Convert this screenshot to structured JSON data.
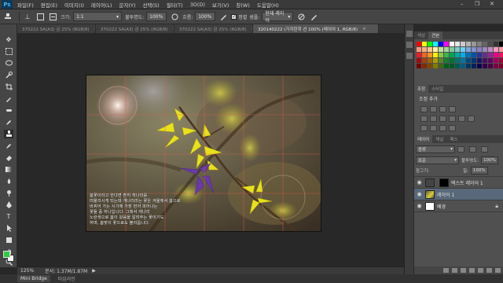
{
  "app": {
    "logo": "Ps"
  },
  "menu": [
    "파일(F)",
    "편집(E)",
    "이미지(I)",
    "레이어(L)",
    "문자(Y)",
    "선택(S)",
    "필터(T)",
    "3D(D)",
    "보기(V)",
    "창(W)",
    "도움말(H)"
  ],
  "window_controls": {
    "minimize": "–",
    "restore": "❐",
    "close": "✕"
  },
  "options": {
    "tool_preset": "⊥",
    "label_size": "크기:",
    "size_value": "1:1",
    "mode_label": "불투명도:",
    "mode_value": "100%",
    "opacity_label": "흐름:",
    "opacity_value": "100%",
    "align_label": "정렬",
    "sample_label": "샘플:",
    "sample_value": "현재 레이어",
    "align_checked": "✓"
  },
  "tabs": [
    {
      "label": "370222 SA(A3) 금 25% (RGB/8)",
      "active": false
    },
    {
      "label": "370222 SA(A3) 금 25% (RGB/8)",
      "active": false
    },
    {
      "label": "370222 SA(A3) 금 25% (RGB/8)",
      "active": false
    },
    {
      "label": "320140222 (가지런히 선 100% (레이어 1, RGB/8)",
      "active": true
    }
  ],
  "tab_close": "×",
  "caption": {
    "lines": [
      "봄꽃이라고 한다면 흔히 개나리를",
      "떠올리시게 되는데 개나리라는 꽃은 겨울에서 봄으로",
      "바뀌어 가는 시기에 가장 먼저 피어나는",
      "꽃들 중 하나입니다. 그래서 개나리",
      "노란색으로 봄이 왔음을 알려주는 꽃이기도",
      "하며, 봄맞이 꽃으로도 불리웁니다."
    ]
  },
  "status": {
    "zoom": "125%",
    "doc": "문서: 1.37M/1.87M",
    "arrow": "▶"
  },
  "bottom_tabs": [
    "Mini Bridge",
    "타임라인"
  ],
  "panels": {
    "swatches_tabs": [
      "색상",
      "견본"
    ],
    "adjust_tabs": [
      "조정",
      "스타일"
    ],
    "adjust_title": "조정 추가",
    "layers_tabs": [
      "레이어",
      "채널",
      "패스"
    ],
    "kind_label": "종류",
    "blend_mode": "표준",
    "opacity_label": "불투명도:",
    "opacity_value": "100%",
    "fill_label": "칠:",
    "fill_value": "100%",
    "lock_label": "잠그기:",
    "layers": [
      {
        "name": "텍스트 레이어 1",
        "selected": false,
        "type": "mask"
      },
      {
        "name": "레이어 1",
        "selected": true,
        "type": "photo"
      },
      {
        "name": "배경",
        "selected": false,
        "type": "white"
      }
    ]
  },
  "colors": {
    "foreground": "#2ecc40",
    "background": "#ffffff",
    "selection": "#59687a",
    "grid": "#e05a4a"
  },
  "swatch_colors": [
    "#ff0000",
    "#ffff00",
    "#00ff00",
    "#00ffff",
    "#0000ff",
    "#ff00ff",
    "#ffffff",
    "#e6e6e6",
    "#cccccc",
    "#b3b3b3",
    "#999999",
    "#808080",
    "#666666",
    "#4d4d4d",
    "#333333",
    "#000000",
    "#f7977a",
    "#f9ad81",
    "#fdc68a",
    "#fff79a",
    "#c4df9b",
    "#a3d39c",
    "#82ca9d",
    "#7bcdc8",
    "#6ecff6",
    "#7ea7d8",
    "#8493ca",
    "#8882be",
    "#a187be",
    "#bc8dbf",
    "#f49ac2",
    "#f6989d",
    "#ed1c24",
    "#f26522",
    "#f7941d",
    "#fff200",
    "#8dc73f",
    "#39b54a",
    "#00a651",
    "#00a99d",
    "#00aeef",
    "#0072bc",
    "#0054a6",
    "#2e3192",
    "#662d91",
    "#92278f",
    "#ec008c",
    "#ed145b",
    "#9e0b0f",
    "#a0410d",
    "#a36209",
    "#aba000",
    "#598527",
    "#1a7b30",
    "#007236",
    "#00746b",
    "#0076a3",
    "#004b80",
    "#003471",
    "#1b1464",
    "#440e62",
    "#630460",
    "#9e005d",
    "#9e0039",
    "#790000",
    "#7b2e00",
    "#7d4900",
    "#827b00",
    "#406618",
    "#005e20",
    "#005826",
    "#005952",
    "#005b7f",
    "#003663",
    "#002157",
    "#0d004c",
    "#32004b",
    "#4b0049",
    "#7b0046",
    "#7a0026"
  ]
}
